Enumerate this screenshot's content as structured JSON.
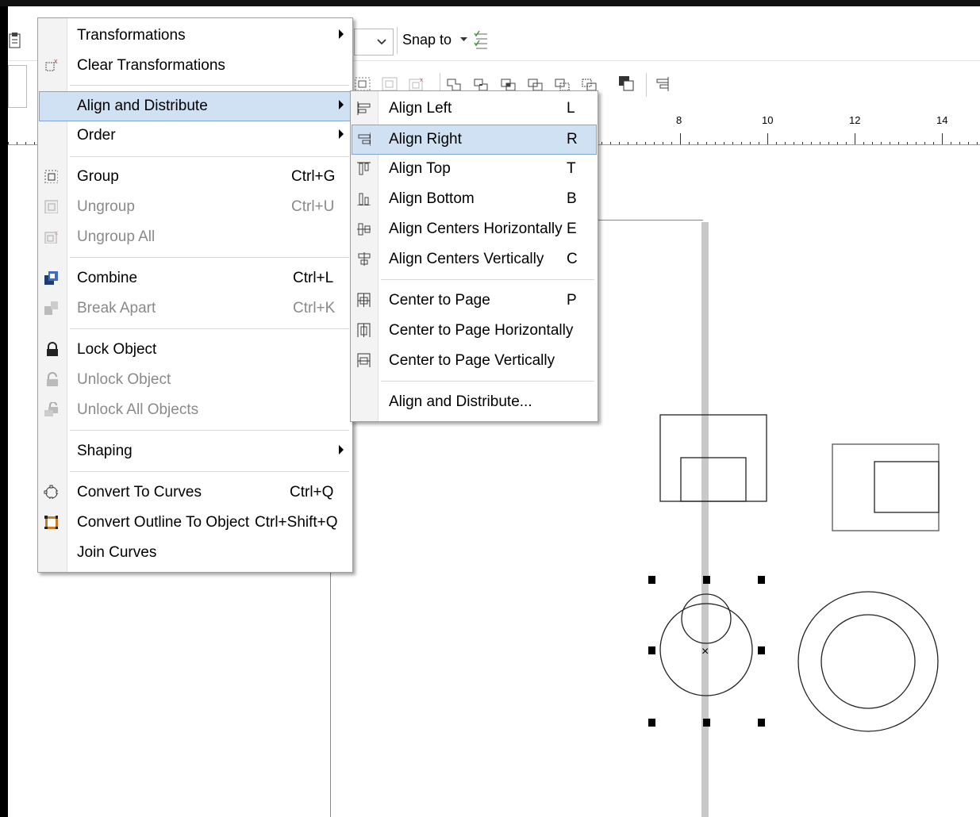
{
  "toolbar": {
    "snap_label": "Snap to",
    "dropdown_arrow": "chevron-down-icon"
  },
  "ruler": {
    "labels": [
      "8",
      "10",
      "12",
      "14"
    ]
  },
  "arrange_menu": {
    "items": [
      {
        "label": "Transformations",
        "shortcut": "",
        "submenu": true,
        "enabled": true
      },
      {
        "label": "Clear Transformations",
        "shortcut": "",
        "submenu": false,
        "enabled": true
      },
      {
        "label": "Align and Distribute",
        "shortcut": "",
        "submenu": true,
        "enabled": true,
        "highlighted": true
      },
      {
        "label": "Order",
        "shortcut": "",
        "submenu": true,
        "enabled": true
      },
      {
        "label": "Group",
        "shortcut": "Ctrl+G",
        "enabled": true
      },
      {
        "label": "Ungroup",
        "shortcut": "Ctrl+U",
        "enabled": false
      },
      {
        "label": "Ungroup All",
        "shortcut": "",
        "enabled": false
      },
      {
        "label": "Combine",
        "shortcut": "Ctrl+L",
        "enabled": true
      },
      {
        "label": "Break Apart",
        "shortcut": "Ctrl+K",
        "enabled": false
      },
      {
        "label": "Lock Object",
        "shortcut": "",
        "enabled": true
      },
      {
        "label": "Unlock Object",
        "shortcut": "",
        "enabled": false
      },
      {
        "label": "Unlock All Objects",
        "shortcut": "",
        "enabled": false
      },
      {
        "label": "Shaping",
        "shortcut": "",
        "submenu": true,
        "enabled": true
      },
      {
        "label": "Convert To Curves",
        "shortcut": "Ctrl+Q",
        "enabled": true
      },
      {
        "label": "Convert Outline To Object",
        "shortcut": "Ctrl+Shift+Q",
        "enabled": true
      },
      {
        "label": "Join Curves",
        "shortcut": "",
        "enabled": true
      }
    ]
  },
  "align_submenu": {
    "items": [
      {
        "label": "Align Left",
        "shortcut": "L"
      },
      {
        "label": "Align Right",
        "shortcut": "R",
        "highlighted": true
      },
      {
        "label": "Align Top",
        "shortcut": "T"
      },
      {
        "label": "Align Bottom",
        "shortcut": "B"
      },
      {
        "label": "Align Centers Horizontally",
        "shortcut": "E"
      },
      {
        "label": "Align Centers Vertically",
        "shortcut": "C"
      },
      {
        "label": "Center to Page",
        "shortcut": "P"
      },
      {
        "label": "Center to Page Horizontally",
        "shortcut": ""
      },
      {
        "label": "Center to Page Vertically",
        "shortcut": ""
      },
      {
        "label": "Align and Distribute...",
        "shortcut": ""
      }
    ]
  },
  "canvas": {
    "selection_center_marker": "×"
  }
}
